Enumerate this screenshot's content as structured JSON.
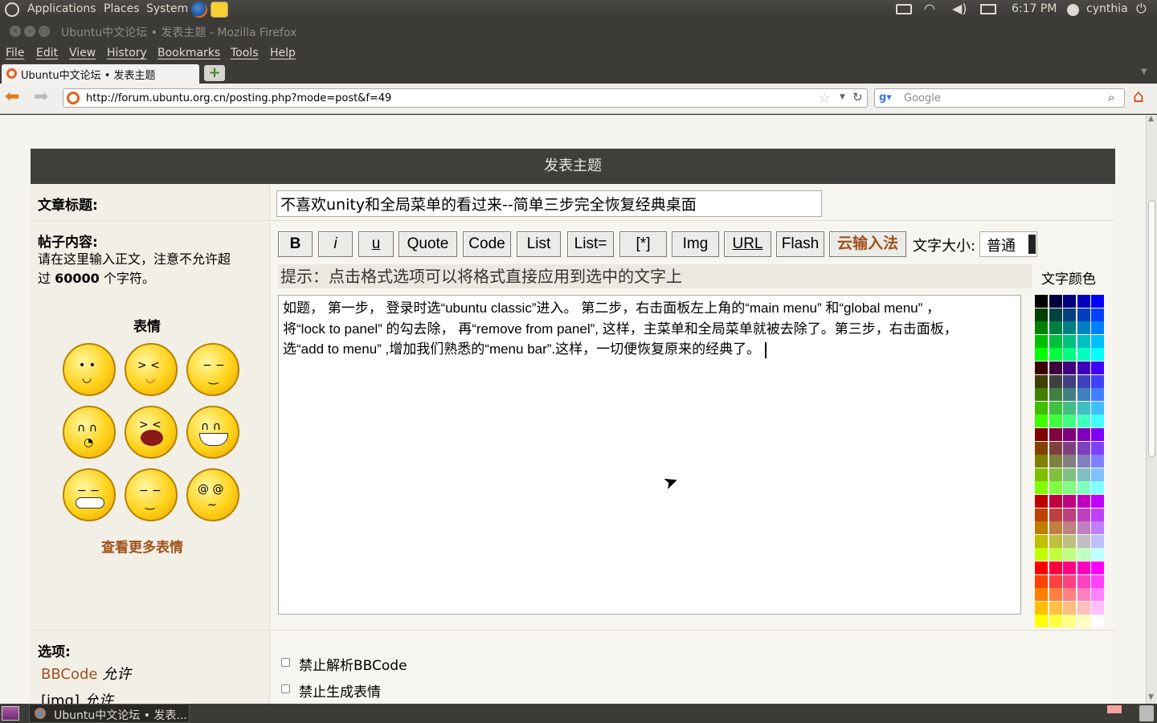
{
  "top_panel": {
    "applications": "Applications",
    "places": "Places",
    "system": "System",
    "clock": "6:17 PM",
    "user": "cynthia"
  },
  "window": {
    "title": "Ubuntu中文论坛 • 发表主题 - Mozilla Firefox"
  },
  "menu": [
    "File",
    "Edit",
    "View",
    "History",
    "Bookmarks",
    "Tools",
    "Help"
  ],
  "tab": {
    "label": "Ubuntu中文论坛 • 发表主题"
  },
  "nav": {
    "url": "http://forum.ubuntu.org.cn/posting.php?mode=post&f=49",
    "search_placeholder": "Google"
  },
  "form": {
    "heading": "发表主题",
    "subject_label": "文章标题:",
    "subject_value": "不喜欢unity和全局菜单的看过来--简单三步完全恢复经典桌面",
    "body_label": "帖子内容:",
    "body_hint_1": "请在这里输入正文，注意不允许超",
    "body_hint_2a": "过 ",
    "body_hint_2b": "60000",
    "body_hint_2c": " 个字符。",
    "emoticons_title": "表情",
    "more_emoticons": "查看更多表情",
    "toolbar": [
      "B",
      "i",
      "u",
      "Quote",
      "Code",
      "List",
      "List=",
      "[*]",
      "Img",
      "URL",
      "Flash"
    ],
    "cloud_ime": "云输入法",
    "font_size_label": "文字大小:",
    "font_size_value": "普通",
    "tip": "提示：点击格式选项可以将格式直接应用到选中的文字上",
    "color_label": "文字颜色",
    "body_text_1": "如题， 第一步， 登录时选“ubuntu classic”进入。 第二步，右击面板左上角的“main menu” 和“global menu” ，",
    "body_text_2": "将“lock to panel” 的勾去除， 再“remove from panel”, 这样，主菜单和全局菜单就被去除了。第三步，右击面板，",
    "body_text_3": "选“add to menu” ,增加我们熟悉的“menu bar”.这样，一切便恢复原来的经典了。",
    "options_label": "选项:",
    "bbcode_status_a": "BBCode",
    "bbcode_status_b": " 允许",
    "img_status_a": "[img]",
    "img_status_b": " 允许",
    "opt_disable_bbcode": "禁止解析BBCode",
    "opt_disable_smilies": "禁止生成表情"
  },
  "taskbar": {
    "window_button": "Ubuntu中文论坛 • 发表..."
  },
  "colors": {
    "accent_brown": "#a0521b",
    "header_bg": "#3f3f3b"
  }
}
